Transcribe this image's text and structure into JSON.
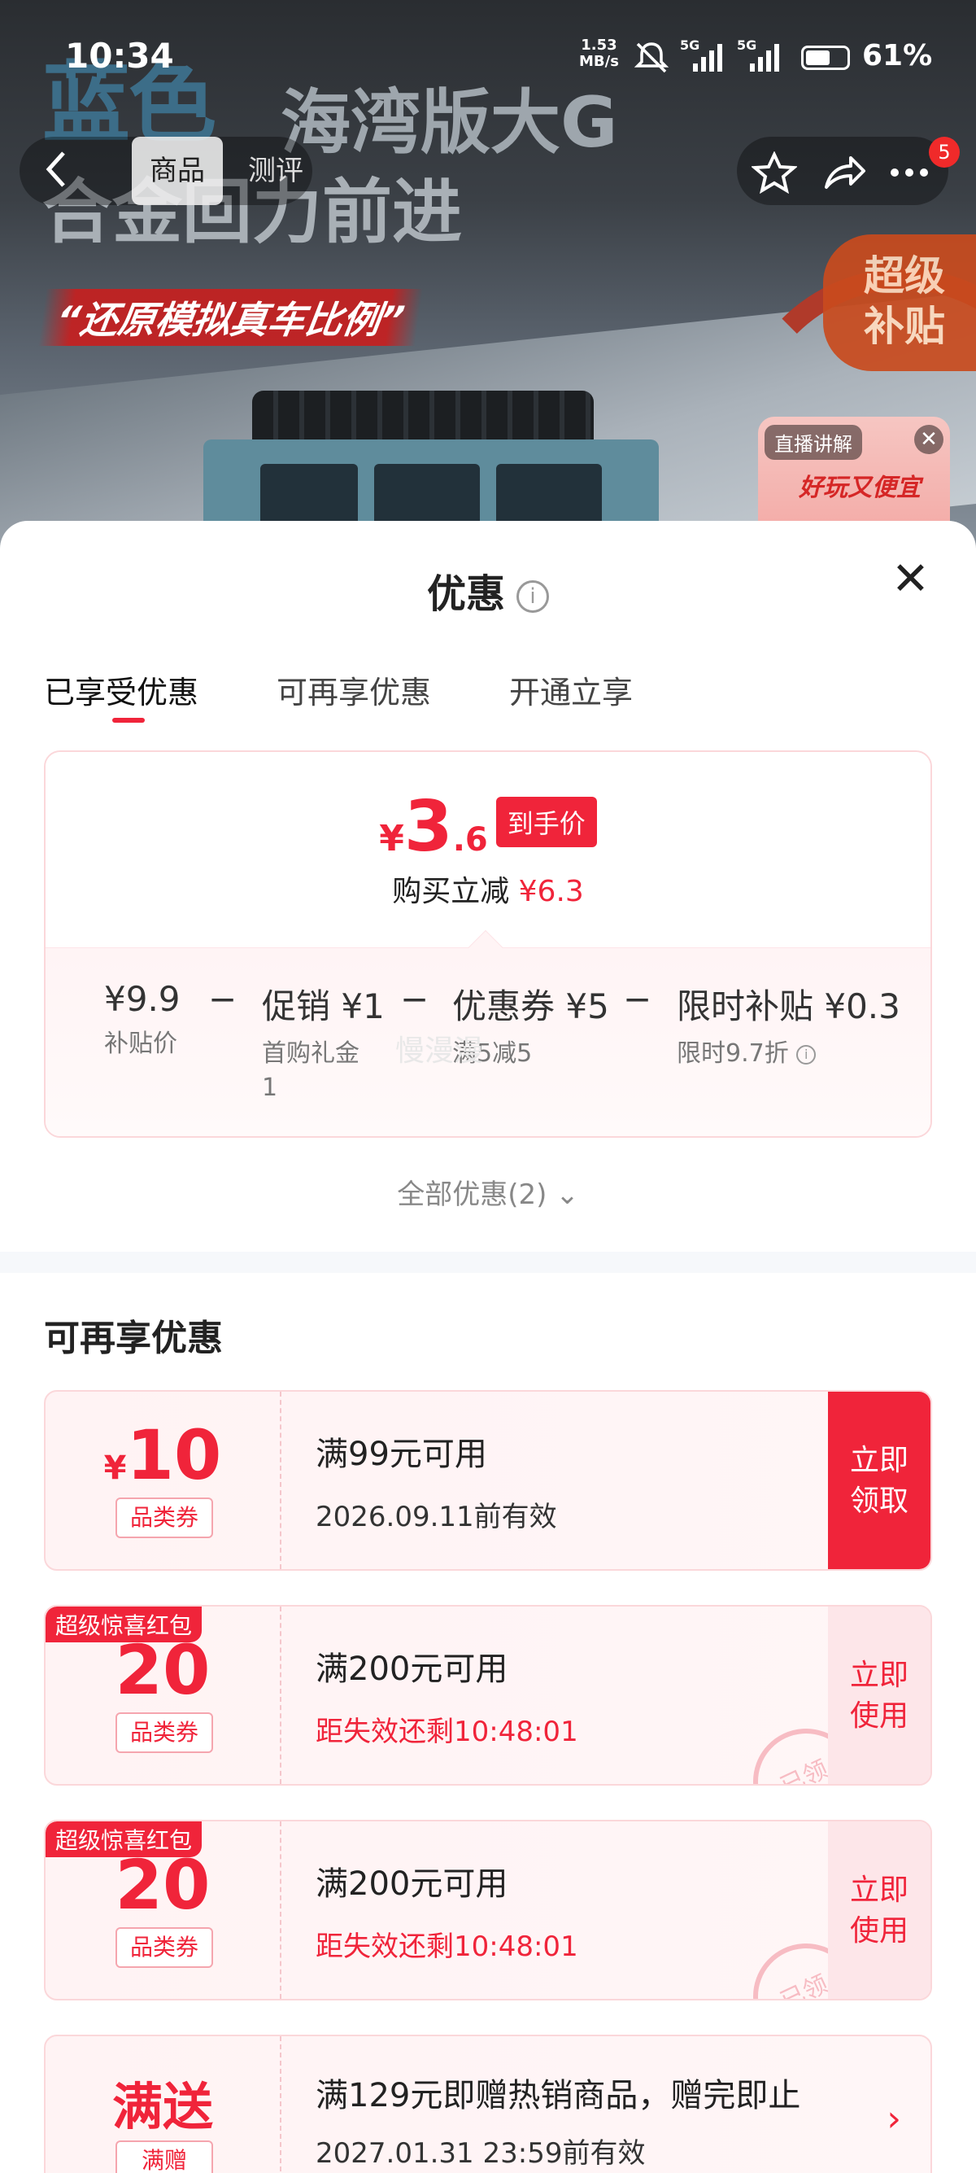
{
  "status_bar": {
    "time": "10:34",
    "net_speed_top": "1.53",
    "net_speed_bottom": "MB/s",
    "sim1": "5G",
    "sim2": "5G",
    "battery_pct": "61%",
    "battery_level": 0.61
  },
  "hero": {
    "title_blue": "蓝色",
    "title_rest": "海湾版大G",
    "title_line2": "合金回力前进",
    "slogan": "“还原模拟真车比例”",
    "subsidy_badge_line1": "超级",
    "subsidy_badge_line2": "补贴",
    "live_tag": "直播讲解",
    "live_close": "✕",
    "live_promo": "好玩又便宜"
  },
  "nav": {
    "back_icon": "back-arrow-icon",
    "tab_goods": "商品",
    "tab_review": "测评",
    "badge_count": "5"
  },
  "sheet": {
    "title": "优惠",
    "info_glyph": "i",
    "close_glyph": "✕",
    "tabs": [
      "已享受优惠",
      "可再享优惠",
      "开通立享"
    ],
    "summary": {
      "yen": "¥",
      "price_int": "3",
      "price_dec": ".6",
      "price_tag": "到手价",
      "discount_label": "购买立减",
      "discount_value": "¥6.3",
      "components": [
        {
          "main": "¥9.9",
          "sub": "补贴价"
        },
        {
          "main": "促销 ¥1",
          "sub": "首购礼金",
          "sub2": "1"
        },
        {
          "main": "优惠券 ¥5",
          "sub": "满5减5"
        },
        {
          "main": "限时补贴 ¥0.3",
          "sub": "限时9.7折"
        }
      ],
      "minus": "−"
    },
    "all_offers": "全部优惠(2)",
    "all_offers_chevron": "⌄",
    "section_title": "可再享优惠",
    "watermark": "慢漫漫"
  },
  "coupons": [
    {
      "yen": "¥",
      "amount": "10",
      "type": "品类券",
      "condition": "满99元可用",
      "valid": "2026.09.11前有效",
      "button_line1": "立即",
      "button_line2": "领取"
    },
    {
      "ribbon": "超级惊喜红包",
      "amount": "20",
      "type": "品类券",
      "condition": "满200元可用",
      "valid": "距失效还剩10:48:01",
      "button_line1": "立即",
      "button_line2": "使用",
      "stamp": "已领"
    },
    {
      "ribbon": "超级惊喜红包",
      "amount": "20",
      "type": "品类券",
      "condition": "满200元可用",
      "valid": "距失效还剩10:48:01",
      "button_line1": "立即",
      "button_line2": "使用",
      "stamp": "已领"
    },
    {
      "amount_text": "满送",
      "type": "满赠",
      "condition": "满129元即赠热销商品，赠完即止",
      "valid": "2027.01.31 23:59前有效",
      "chevron": "›"
    }
  ],
  "colors": {
    "accent_red": "#f0243a",
    "coupon_bg": "#fff3f4",
    "coupon_border": "#fbd7da"
  }
}
